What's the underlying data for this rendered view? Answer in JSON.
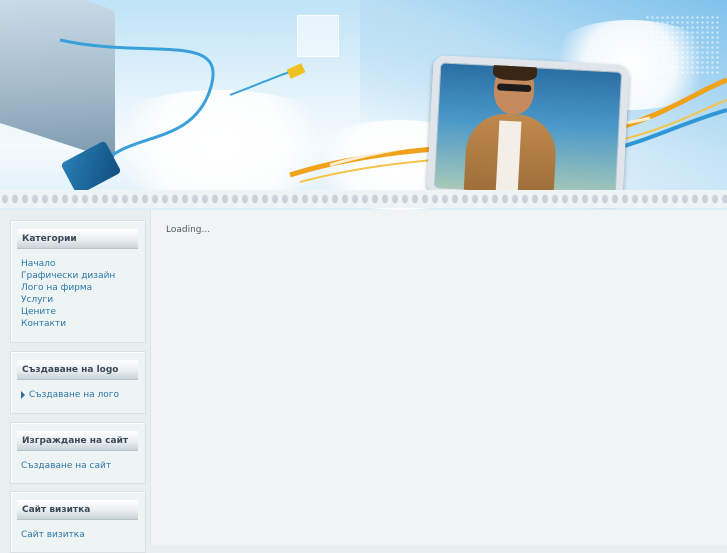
{
  "main": {
    "loading_text": "Loading..."
  },
  "sidebar": {
    "modules": [
      {
        "title": "Категории",
        "links": [
          "Начало",
          "Графически дизайн",
          "Лого на фирма",
          "Услуги",
          "Цените",
          "Контакти"
        ]
      },
      {
        "title": "Създаване на logo",
        "links": [
          "Създаване на лого"
        ]
      },
      {
        "title": "Изграждане на сайт",
        "links": [
          "Създаване на сайт"
        ]
      },
      {
        "title": "Сайт визитка",
        "links": [
          "Сайт визитка"
        ]
      }
    ]
  },
  "colors": {
    "link": "#2c79a8",
    "title_text": "#3b4a57",
    "background": "#e9eef0"
  }
}
